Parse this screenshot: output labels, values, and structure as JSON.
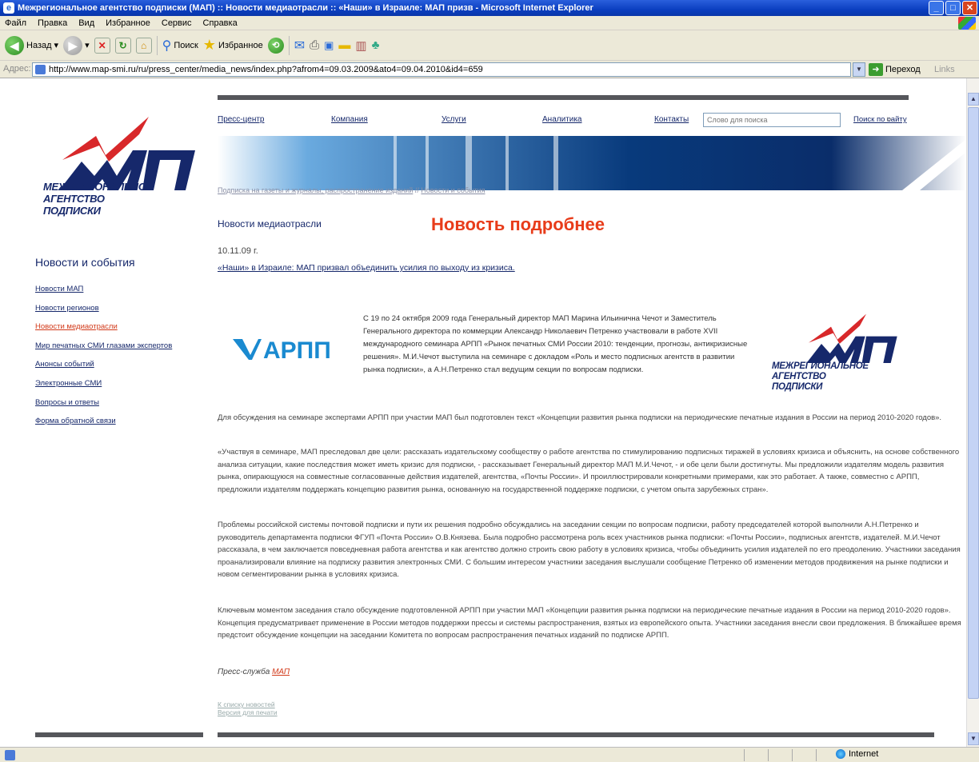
{
  "window": {
    "title": "Межрегиональное агентство подписки (МАП) :: Новости медиаотрасли :: «Наши» в Израиле: МАП призв - Microsoft Internet Explorer"
  },
  "menu": [
    "Файл",
    "Правка",
    "Вид",
    "Избранное",
    "Сервис",
    "Справка"
  ],
  "toolbar": {
    "back_label": "Назад",
    "search_label": "Поиск",
    "favorites_label": "Избранное"
  },
  "address": {
    "label": "Адрес:",
    "url": "http://www.map-smi.ru/ru/press_center/media_news/index.php?afrom4=09.03.2009&ato4=09.04.2010&id4=659",
    "go_label": "Переход",
    "links_label": "Links"
  },
  "status": {
    "zone": "Internet"
  },
  "logo": {
    "lines": [
      "МЕЖРЕГИОНАЛЬНОЕ",
      "АГЕНТСТВО",
      "ПОДПИСКИ"
    ]
  },
  "sidebar": {
    "title": "Новости и события",
    "items": [
      {
        "label": "Новости МАП"
      },
      {
        "label": "Новости регионов"
      },
      {
        "label": "Новости медиаотрасли"
      },
      {
        "label": "Мир печатных СМИ глазами экспертов"
      },
      {
        "label": "Анонсы событий"
      },
      {
        "label": "Электронные СМИ"
      },
      {
        "label": "Вопросы и ответы"
      },
      {
        "label": "Форма обратной связи"
      }
    ]
  },
  "topnav": {
    "items": [
      "Пресс-центр",
      "Компания",
      "Услуги",
      "Аналитика",
      "Контакты"
    ],
    "search_placeholder": "Слово для поиска",
    "search_link": "Поиск по сайту"
  },
  "breadcrumb": {
    "link1": "Подписка на газеты и журналы, распространение изданий",
    "sep": " // ",
    "link2": "Новости и события"
  },
  "article": {
    "section": "Новости медиаотрасли",
    "heading": "Новость подробнее",
    "date": "10.11.09 г.",
    "title": "«Наши» в Израиле: МАП призвал объединить усилия по выходу из кризиса.",
    "arpp_logo": "АРПП",
    "lead": "С 19 по 24 октября 2009 года Генеральный директор МАП Марина Ильинична Чечот и Заместитель Генерального директора по коммерции Александр Николаевич Петренко участвовали в работе XVII международного семинара АРПП «Рынок печатных СМИ России 2010: тенденции, прогнозы, антикризисные решения». М.И.Чечот выступила на семинаре с докладом «Роль и место подписных агентств в развитии рынка подписки», а А.Н.Петренко стал ведущим секции по вопросам подписки.",
    "p1": "Для обсуждения на семинаре экспертами АРПП при участии МАП был подготовлен текст «Концепции развития рынка подписки на периодические печатные издания в России на период 2010-2020 годов».",
    "p2": "«Участвуя в семинаре, МАП преследовал две цели: рассказать издательскому сообществу о работе агентства по стимулированию подписных тиражей в условиях кризиса и объяснить, на основе собственного анализа ситуации, какие последствия может иметь кризис для подписки, - рассказывает Генеральный директор МАП М.И.Чечот, - и обе цели были достигнуты. Мы предложили издателям модель развития рынка, опирающуюся на совместные согласованные действия издателей, агентства, «Почты России». И проиллюстрировали конкретными примерами, как это работает. А также, совместно с АРПП, предложили издателям поддержать концепцию развития рынка, основанную на государственной поддержке подписки, с учетом опыта зарубежных стран».",
    "p3": "Проблемы российской системы почтовой подписки и пути их решения подробно обсуждались на заседании секции по вопросам подписки, работу председателей которой выполнили А.Н.Петренко и руководитель департамента подписки ФГУП «Почта России» О.В.Князева. Была подробно рассмотрена роль всех участников рынка подписки: «Почты России», подписных агентств, издателей. М.И.Чечот рассказала, в чем заключается повседневная работа агентства и как агентство должно строить свою работу в условиях кризиса, чтобы объединить усилия издателей по его преодолению. Участники заседания проанализировали влияние на подписку развития электронных СМИ. С большим интересом участники заседания выслушали сообщение Петренко об изменении методов продвижения на рынке подписки и новом сегментировании рынка в условиях кризиса.",
    "p4": "Ключевым моментом заседания стало обсуждение подготовленной АРПП при участии МАП «Концепции развития рынка подписки на периодические печатные издания в России на период 2010-2020 годов». Концепция предусматривает применение в России методов поддержки прессы и системы распространения, взятых из европейского опыта. Участники заседания внесли свои предложения. В ближайшее время предстоит обсуждение концепции на заседании Комитета по вопросам распространения печатных изданий по подписке АРПП.",
    "sign_prefix": "Пресс-служба ",
    "sign_link": "МАП",
    "back_link": "К списку новостей",
    "print_link": "Версия для печати"
  }
}
